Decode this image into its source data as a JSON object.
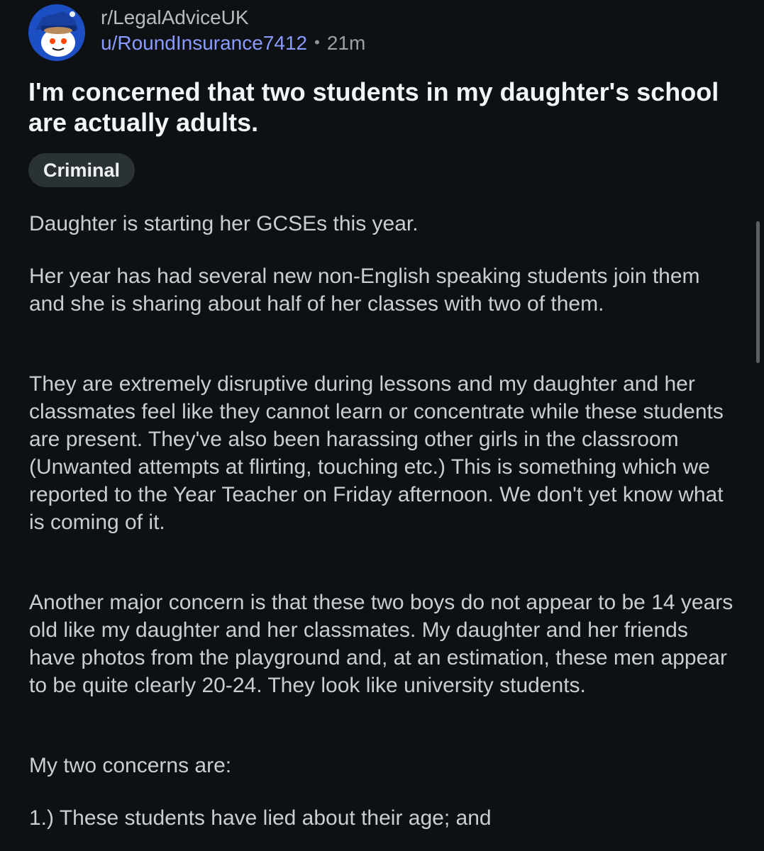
{
  "post": {
    "subreddit": "r/LegalAdviceUK",
    "username": "u/RoundInsurance7412",
    "separator": "•",
    "time_ago": "21m",
    "title": "I'm concerned that two students in my daughter's school are actually adults.",
    "flair": "Criminal",
    "paragraphs": [
      "Daughter is starting her GCSEs this year.",
      "Her year has had several new non-English speaking students join them and she is sharing about half of her classes with two of them.",
      "They are extremely disruptive during lessons and my daughter and her classmates feel like they cannot learn or concentrate while these students are present. They've also been harassing other girls in the classroom (Unwanted attempts at flirting, touching etc.) This is something which we reported to the Year Teacher on Friday afternoon. We don't yet know what is coming of it.",
      "Another major concern is that these two boys do not appear to be 14 years old like my daughter and her classmates. My daughter and her friends have photos from the playground and, at an estimation, these men appear to be quite clearly 20-24. They look like university students.",
      "My two concerns are:",
      "1.) These students have lied about their age; and"
    ]
  },
  "colors": {
    "background": "#0e1113",
    "username": "#8a9bff",
    "flair_bg": "#2a3236"
  },
  "icons": {
    "avatar": "reddit-snoo-avatar-icon"
  }
}
